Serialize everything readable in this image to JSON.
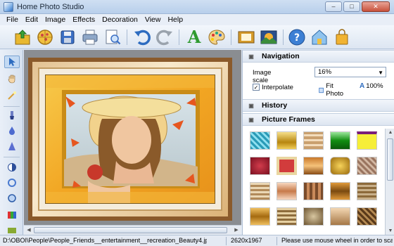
{
  "window": {
    "title": "Home Photo Studio",
    "buttons": [
      "–",
      "□",
      "✕"
    ]
  },
  "menu": [
    "File",
    "Edit",
    "Image",
    "Effects",
    "Decoration",
    "View",
    "Help"
  ],
  "toolbar": {
    "icons": [
      "open-icon",
      "pizza-icon",
      "save-icon",
      "print-icon",
      "preview-icon",
      "undo-icon",
      "redo-icon",
      "text-icon",
      "palette-icon",
      "frame-icon",
      "wallpaper-icon",
      "help-icon",
      "home-icon",
      "shop-bag-icon"
    ],
    "text_glyph": "A"
  },
  "left_tools": [
    "pointer-icon",
    "hand-icon",
    "magic-wand-icon",
    "brush-icon",
    "drop-icon",
    "cone-icon",
    "contrast-icon",
    "circle-icon",
    "ring-icon",
    "palette-bars-icon",
    "gradient-icon"
  ],
  "navigation": {
    "title": "Navigation",
    "image_scale_label": "Image scale",
    "image_scale_value": "16%",
    "interpolate_label": "Interpolate",
    "interpolate_checked": true,
    "check_glyph": "✓",
    "fit_photo_label": "Fit Photo",
    "percent_label": "100%",
    "percent_glyph": "A"
  },
  "history": {
    "title": "History"
  },
  "picture_frames": {
    "title": "Picture Frames",
    "tile_count": 25
  },
  "status": {
    "path": "D:\\OBOI\\People\\People_Friends__entertainment__recreation_Beauty4.jpg",
    "size": "2620x1967",
    "hint": "Please use mouse wheel in order to scale im"
  },
  "colors": {
    "accent": "#2d6cc0",
    "frame_gold": "#e0a52a"
  }
}
